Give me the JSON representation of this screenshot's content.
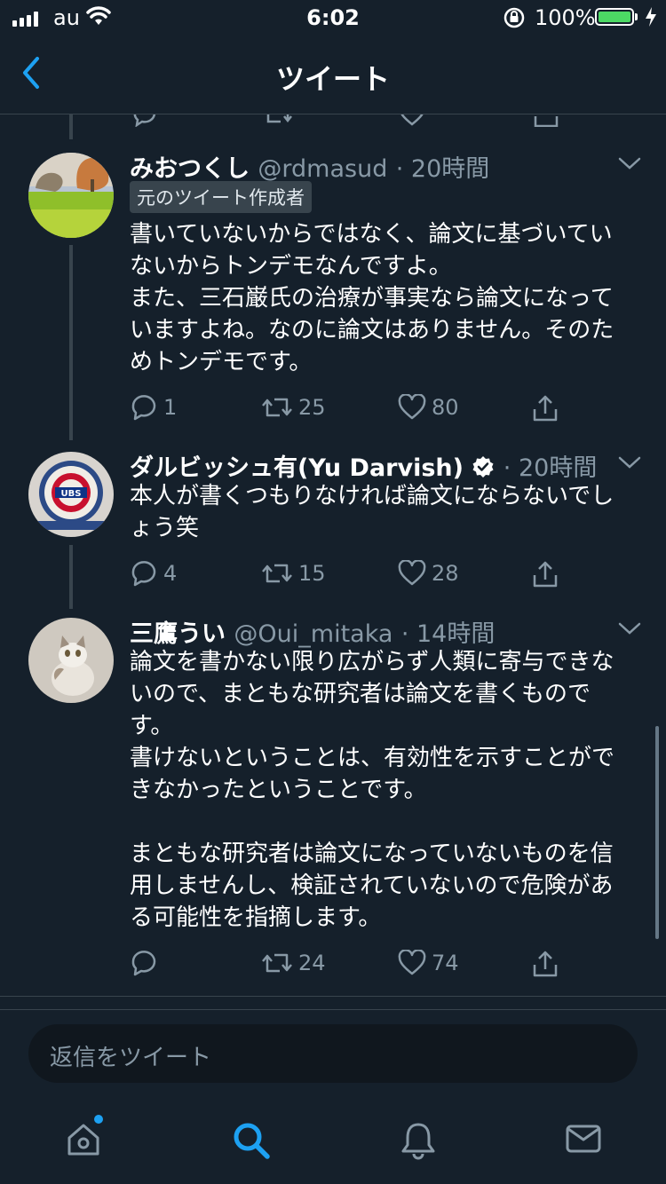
{
  "status_bar": {
    "carrier": "au",
    "time": "6:02",
    "battery_pct": "100%",
    "battery_level": 1.0
  },
  "nav": {
    "title": "ツイート"
  },
  "tweets": [
    {
      "name": "みおつくし",
      "handle": "@rdmasud",
      "time": "· 20時間",
      "badge": "元のツイート作成者",
      "text": "書いていないからではなく、論文に基づいていないからトンデモなんですよ。\nまた、三石巌氏の治療が事実なら論文になっていますよね。なのに論文はありません。そのためトンデモです。",
      "replies": "1",
      "retweets": "25",
      "likes": "80"
    },
    {
      "name": "ダルビッシュ有(Yu Darvish)",
      "time": "· 20時間",
      "text": "本人が書くつもりなければ論文にならないでしょう笑",
      "replies": "4",
      "retweets": "15",
      "likes": "28",
      "verified": true
    },
    {
      "name": "三鷹うい",
      "handle": "@Oui_mitaka",
      "time": "· 14時間",
      "text": "論文を書かない限り広がらず人類に寄与できないので、まともな研究者は論文を書くものです。\n書けないということは、有効性を示すことができなかったということです。\n\nまともな研究者は論文になっていないものを信用しませんし、検証されていないので危険がある可能性を指摘します。",
      "replies": "",
      "retweets": "24",
      "likes": "74"
    }
  ],
  "reply_bar": {
    "placeholder": "返信をツイート"
  },
  "tabs": [
    "home-tab",
    "search-tab",
    "notifications-tab",
    "messages-tab"
  ],
  "colors": {
    "background": "#15202b",
    "accent": "#1da1f2",
    "muted": "#8899a6",
    "divider": "#38444d"
  }
}
